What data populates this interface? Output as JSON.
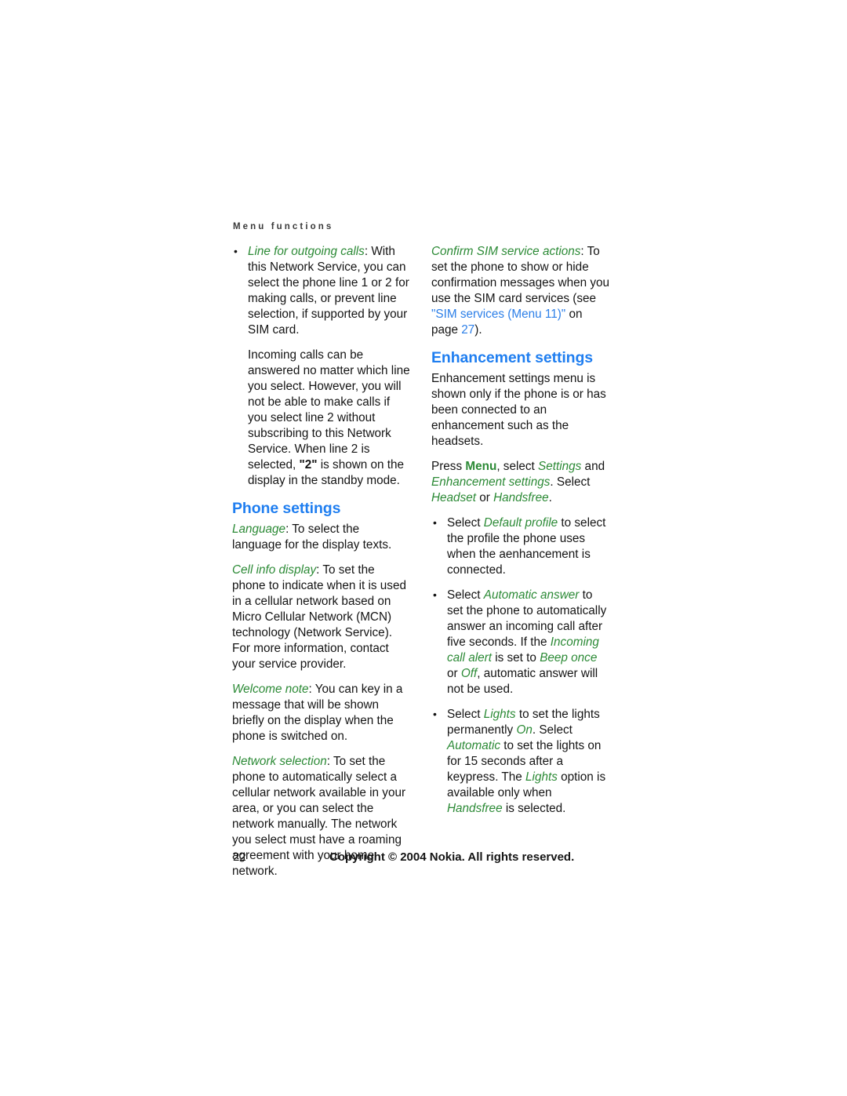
{
  "document": {
    "running_header": "Menu functions",
    "page_number": "22",
    "copyright": "Copyright © 2004 Nokia. All rights reserved.",
    "colors": {
      "heading_blue": "#1f7ef0",
      "term_green": "#2c8a36",
      "link_blue": "#2c7fe8",
      "body_text": "#141414",
      "background": "#ffffff"
    }
  },
  "left_column": {
    "bullet_line_for_outgoing_calls": {
      "term": "Line for outgoing calls",
      "text": ": With this Network Service, you can select the phone line 1 or 2 for making calls, or prevent line selection, if supported by your SIM card."
    },
    "paragraph_incoming_calls": {
      "part1": "Incoming calls can be answered no matter which line you select. However, you will not be able to make calls if you select line 2 without subscribing to this Network Service. When line 2 is selected, ",
      "quoted": "\"2\"",
      "part2": " is shown on the display in the standby mode."
    },
    "heading_phone_settings": "Phone settings",
    "paragraph_language": {
      "term": "Language",
      "text": ": To select the language for the display texts."
    },
    "paragraph_cell_info_display": {
      "term": "Cell info display",
      "text": ": To set the phone to indicate when it is used in a cellular network based on Micro Cellular Network (MCN) technology (Network Service). For more information, contact your service provider."
    },
    "paragraph_welcome_note": {
      "term": "Welcome note",
      "text": ": You can key in a message that will be shown briefly on the display when the phone is switched on."
    },
    "paragraph_network_selection": {
      "term": "Network selection",
      "text": ": To set the phone to automatically select a cellular network available in your area, or you can select the network manually. The network you select must have a roaming agreement with your home network."
    }
  },
  "right_column": {
    "paragraph_confirm_sim": {
      "term": "Confirm SIM service actions",
      "text_before_link": ": To set the phone to show or hide confirmation messages when you use the SIM card services (see ",
      "link_text": "\"SIM services (Menu 11)\"",
      "text_middle": " on page ",
      "link_page": "27",
      "text_after": ")."
    },
    "heading_enhancement_settings": "Enhancement settings",
    "paragraph_intro": "Enhancement settings menu is shown only if the phone is or has been connected to an enhancement such as the headsets.",
    "paragraph_press_menu": {
      "text1": "Press ",
      "menu_key": "Menu",
      "text2": ", select ",
      "term_settings": "Settings",
      "text3": " and ",
      "term_enhancement_settings": "Enhancement settings",
      "text4": ". Select ",
      "term_headset": "Headset",
      "text5": " or ",
      "term_handsfree": "Handsfree",
      "text6": "."
    },
    "bullet_default_profile": {
      "text1": "Select ",
      "term": "Default profile",
      "text2": " to select the profile the phone uses when the aenhancement is connected."
    },
    "bullet_automatic_answer": {
      "text1": "Select ",
      "term1": "Automatic answer",
      "text2": " to set the phone to automatically answer an incoming call after five seconds. If the ",
      "term2": "Incoming call alert",
      "text3": " is set to ",
      "term3": "Beep once",
      "text4": " or ",
      "term4": "Off",
      "text5": ", automatic answer will not be used."
    },
    "bullet_lights": {
      "text1": "Select ",
      "term1": "Lights",
      "text2": " to set the lights permanently ",
      "term2": "On",
      "text3": ". Select ",
      "term3": "Automatic",
      "text4": " to set the lights on for 15 seconds after a keypress. The ",
      "term4": "Lights",
      "text5": " option is available only when ",
      "term5": "Handsfree",
      "text6": " is selected."
    }
  }
}
